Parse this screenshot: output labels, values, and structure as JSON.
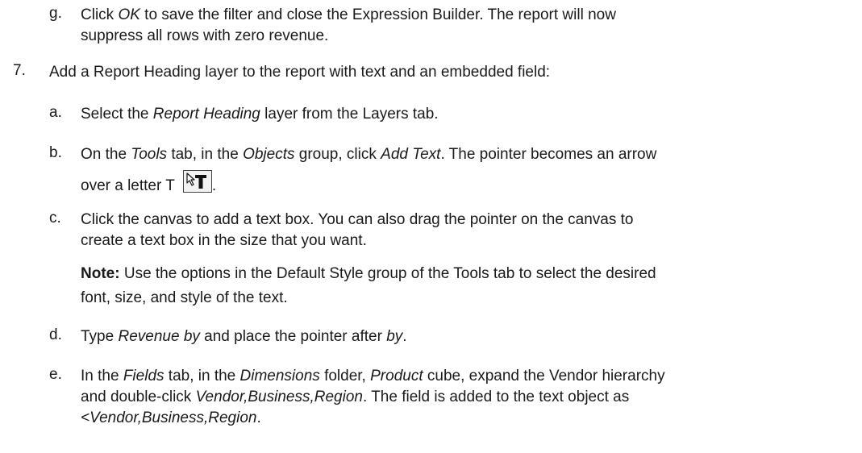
{
  "items": {
    "g": {
      "marker": "g.",
      "line1": {
        "t0": "Click ",
        "t1": "OK",
        "t2": " to save the filter and close the Expression Builder. The report will now"
      },
      "line2": "suppress all rows with zero revenue."
    },
    "step7": {
      "marker": "7.",
      "text": "Add a Report Heading layer to the report with text and an embedded field:"
    },
    "a": {
      "marker": "a.",
      "t0": "Select the ",
      "t1": "Report Heading",
      "t2": " layer from the Layers tab."
    },
    "b": {
      "marker": "b.",
      "line1": {
        "t0": "On the ",
        "t1": "Tools",
        "t2": " tab, in the ",
        "t3": "Objects",
        "t4": " group, click ",
        "t5": "Add Text",
        "t6": ". The pointer becomes an arrow"
      },
      "line2": {
        "t0": "over a letter T ",
        "t1": "."
      },
      "icon": "arrow-over-letter-t-cursor-icon"
    },
    "c": {
      "marker": "c.",
      "line1": "Click the canvas to add a text box. You can also drag the pointer on the canvas to",
      "line2": "create a text box in the size that you want."
    },
    "note": {
      "label": "Note:",
      "line1": " Use the options in the Default Style group of the Tools tab to select the desired",
      "line2": "font, size, and style of the text."
    },
    "d": {
      "marker": "d.",
      "t0": "Type ",
      "t1": "Revenue by",
      "t2": " and place the pointer after ",
      "t3": "by",
      "t4": "."
    },
    "e": {
      "marker": "e.",
      "line1": {
        "t0": "In the ",
        "t1": "Fields",
        "t2": " tab, in the ",
        "t3": "Dimensions",
        "t4": " folder, ",
        "t5": "Product",
        "t6": " cube, expand the Vendor hierarchy"
      },
      "line2": {
        "t0": "and double-click ",
        "t1": "Vendor,Business,Region",
        "t2": ". The field is added to the text object as"
      },
      "line3": {
        "t0": "<Vendor,Business,Region",
        "t1": "."
      }
    }
  }
}
